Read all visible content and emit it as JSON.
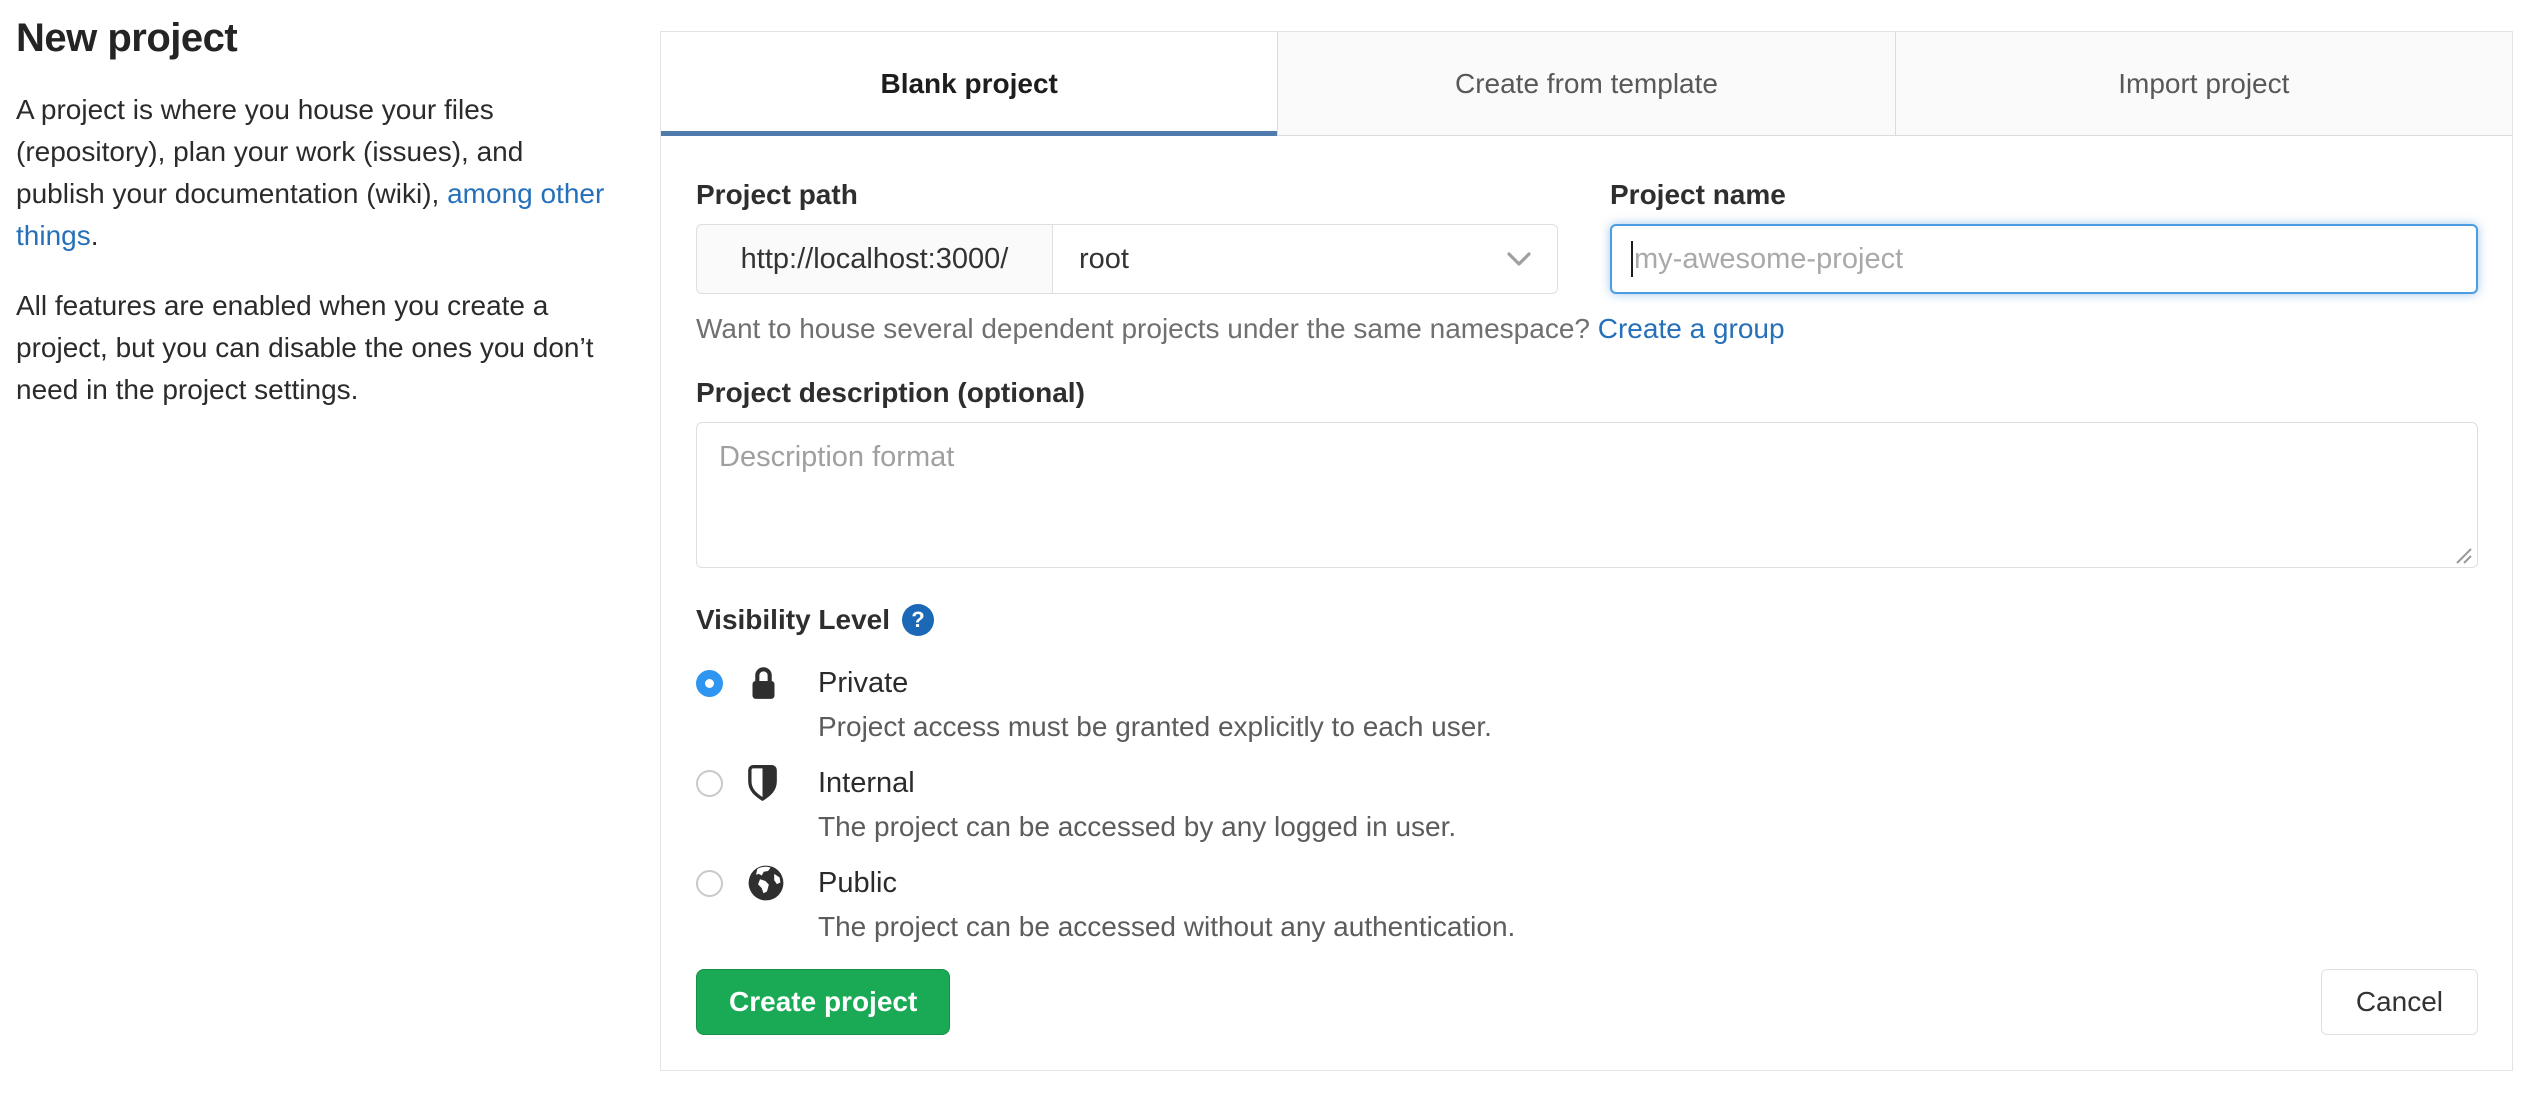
{
  "sidebar": {
    "title": "New project",
    "intro_before_link": "A project is where you house your files (repository), plan your work (issues), and publish your documentation (wiki), ",
    "intro_link": "among other things",
    "intro_after_link": ".",
    "paragraph2": "All features are enabled when you create a project, but you can disable the ones you don’t need in the project settings."
  },
  "tabs": [
    {
      "label": "Blank project",
      "active": true
    },
    {
      "label": "Create from template",
      "active": false
    },
    {
      "label": "Import project",
      "active": false
    }
  ],
  "form": {
    "project_path": {
      "label": "Project path",
      "url_prefix": "http://localhost:3000/",
      "namespace_selected": "root"
    },
    "project_name": {
      "label": "Project name",
      "placeholder": "my-awesome-project",
      "value": ""
    },
    "namespace_help_text": "Want to house several dependent projects under the same namespace? ",
    "namespace_help_link": "Create a group",
    "description": {
      "label": "Project description (optional)",
      "placeholder": "Description format",
      "value": ""
    },
    "visibility": {
      "label": "Visibility Level",
      "help_icon": "question-mark",
      "options": [
        {
          "name": "Private",
          "icon": "lock-icon",
          "selected": true,
          "description": "Project access must be granted explicitly to each user."
        },
        {
          "name": "Internal",
          "icon": "shield-icon",
          "selected": false,
          "description": "The project can be accessed by any logged in user."
        },
        {
          "name": "Public",
          "icon": "globe-icon",
          "selected": false,
          "description": "The project can be accessed without any authentication."
        }
      ]
    },
    "submit_label": "Create project",
    "cancel_label": "Cancel"
  },
  "colors": {
    "accent_link_blue": "#2570b9",
    "tab_active_underline": "#4f7cac",
    "button_green": "#1aaa55",
    "radio_selected_blue": "#2e95f0",
    "help_icon_blue": "#1b69b6",
    "focus_border_blue": "#4a9de0"
  }
}
